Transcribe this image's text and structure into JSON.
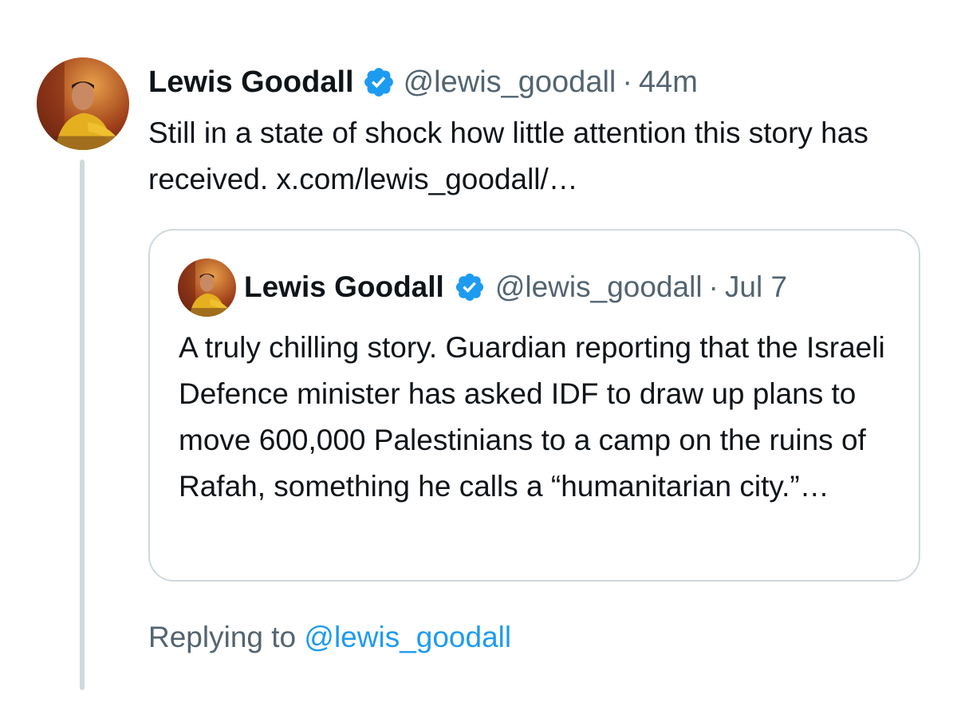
{
  "tweet": {
    "author_name": "Lewis Goodall",
    "author_handle": "@lewis_goodall",
    "separator": "·",
    "time": "44m",
    "text_before_link": "Still in a state of shock how little attention this story has received. ",
    "link_text": "x.com/lewis_goodall/…",
    "verified_badge": "verified-badge-icon",
    "badge_color": "#1d9bf0"
  },
  "quoted_tweet": {
    "author_name": "Lewis Goodall",
    "author_handle": "@lewis_goodall",
    "separator": "·",
    "time": "Jul 7",
    "text": "A truly chilling story. Guardian reporting that the Israeli Defence minister has asked IDF to draw up plans to move 600,000 Palestinians to a camp on the ruins of Rafah, something he calls a “humanitarian city.”…"
  },
  "reply_context": {
    "prefix": "Replying to ",
    "mention": "@lewis_goodall"
  },
  "colors": {
    "text_primary": "#0f1419",
    "text_secondary": "#536471",
    "accent": "#1d9bf0",
    "border": "#cfd9de"
  }
}
